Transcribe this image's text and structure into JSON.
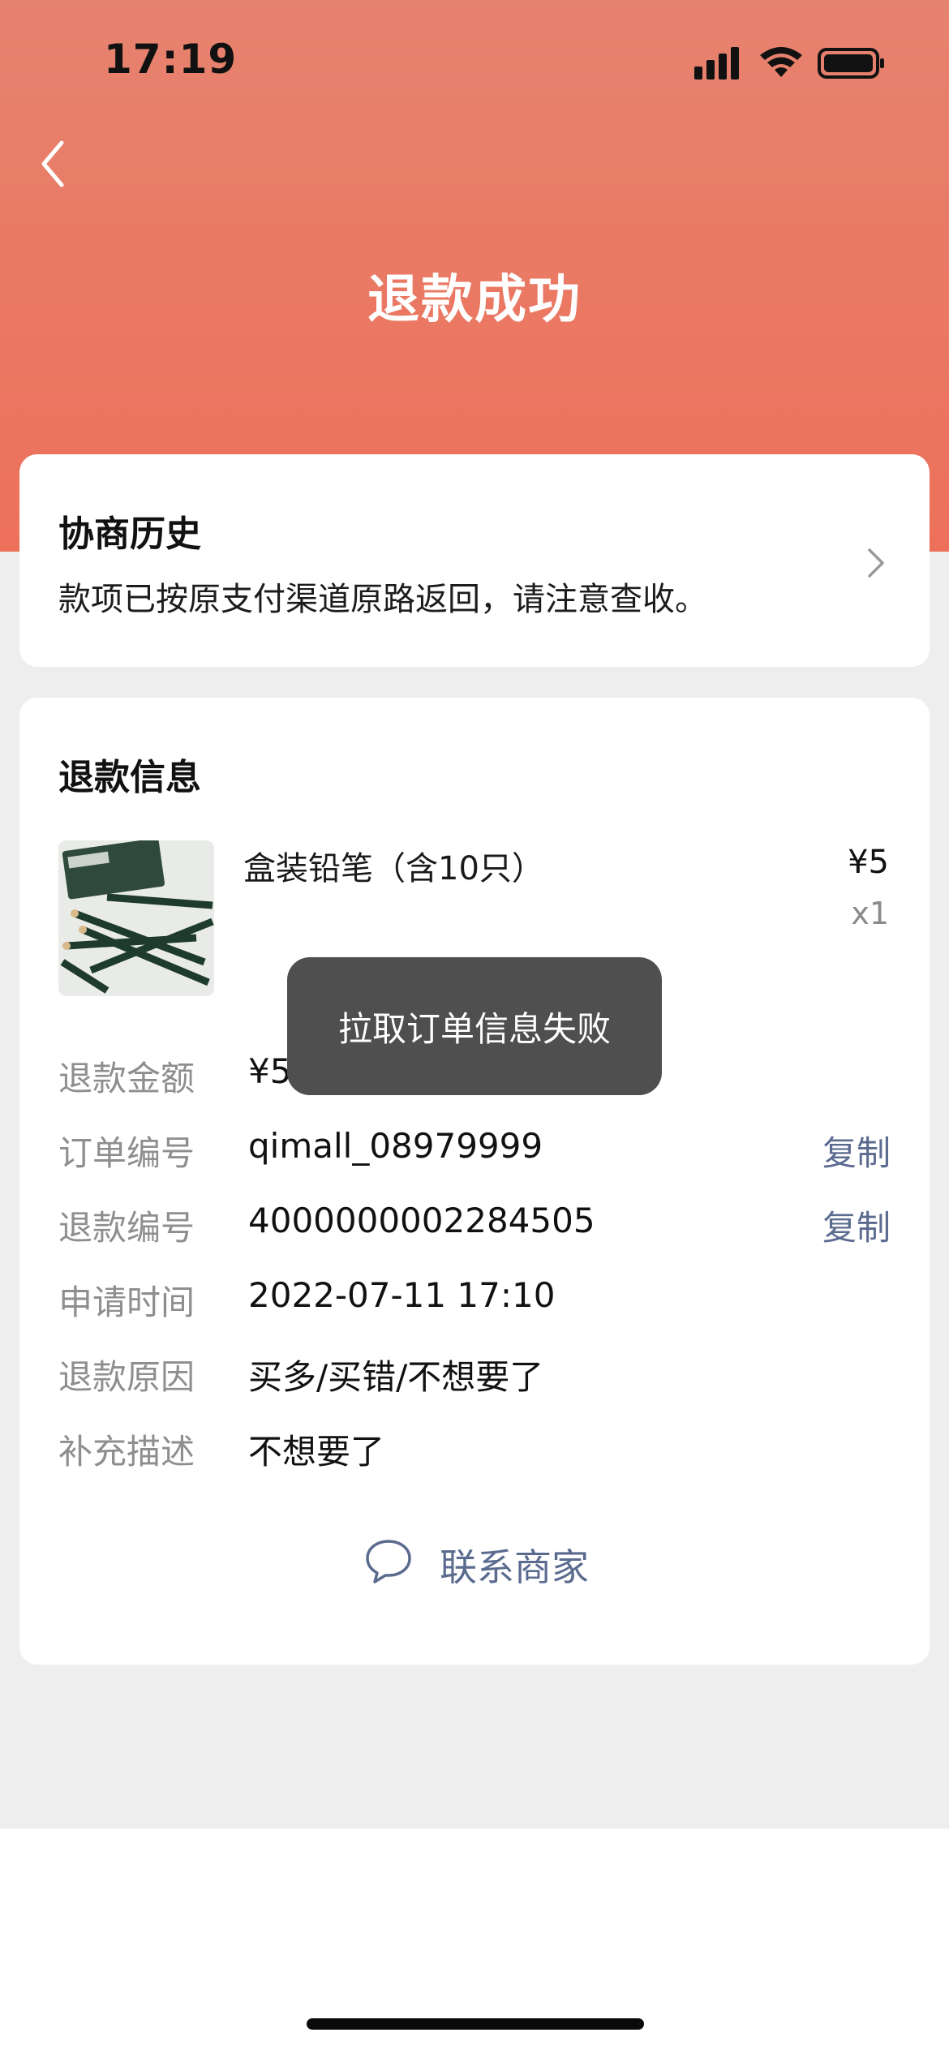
{
  "status_bar": {
    "time": "17:19"
  },
  "header": {
    "title": "退款成功"
  },
  "history": {
    "title": "协商历史",
    "description": "款项已按原支付渠道原路返回，请注意查收。"
  },
  "refund_info": {
    "section_title": "退款信息",
    "product": {
      "name": "盒装铅笔（含10只）",
      "price": "¥5",
      "quantity": "x1"
    },
    "rows": [
      {
        "label": "退款金额",
        "value": "¥5",
        "action": ""
      },
      {
        "label": "订单编号",
        "value": "qimall_08979999",
        "action": "复制"
      },
      {
        "label": "退款编号",
        "value": "4000000002284505",
        "action": "复制"
      },
      {
        "label": "申请时间",
        "value": "2022-07-11 17:10",
        "action": ""
      },
      {
        "label": "退款原因",
        "value": "买多/买错/不想要了",
        "action": ""
      },
      {
        "label": "补充描述",
        "value": "不想要了",
        "action": ""
      }
    ],
    "contact_label": "联系商家"
  },
  "toast": {
    "message": "拉取订单信息失败"
  },
  "colors": {
    "header_gradient_top": "#e6836f",
    "header_gradient_bottom": "#ed705a",
    "link_color": "#5b6b8f",
    "toast_bg": "#4f4f4f"
  },
  "icons": [
    "back-icon",
    "chevron-right-icon",
    "chat-bubble-icon",
    "signal-icon",
    "wifi-icon",
    "battery-icon"
  ]
}
